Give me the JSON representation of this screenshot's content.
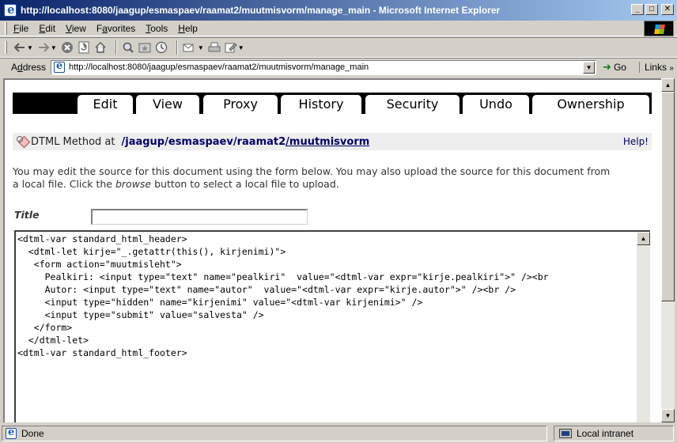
{
  "window": {
    "title": "http://localhost:8080/jaagup/esmaspaev/raamat2/muutmisvorm/manage_main - Microsoft Internet Explorer",
    "min_label": "_",
    "max_label": "□",
    "close_label": "✕"
  },
  "menu": {
    "items": [
      {
        "ul": "F",
        "rest": "ile"
      },
      {
        "ul": "E",
        "rest": "dit"
      },
      {
        "ul": "V",
        "rest": "iew"
      },
      {
        "pre": "F",
        "ul": "a",
        "rest": "vorites"
      },
      {
        "ul": "T",
        "rest": "ools"
      },
      {
        "ul": "H",
        "rest": "elp"
      }
    ]
  },
  "toolbar": {
    "icons": [
      "back-icon",
      "forward-icon",
      "stop-icon",
      "refresh-icon",
      "home-icon",
      "search-icon",
      "favorites-icon",
      "history-icon",
      "mail-icon",
      "print-icon",
      "edit-icon"
    ]
  },
  "address": {
    "label_ul": "d",
    "label_pre": "A",
    "label_rest": "dress",
    "url": "http://localhost:8080/jaagup/esmaspaev/raamat2/muutmisvorm/manage_main",
    "go_label": "Go",
    "links_label": "Links"
  },
  "tabs": [
    {
      "label": "Edit",
      "active": true
    },
    {
      "label": "View"
    },
    {
      "label": "Proxy"
    },
    {
      "label": "History"
    },
    {
      "label": "Security"
    },
    {
      "label": "Undo"
    },
    {
      "label": "Ownership"
    }
  ],
  "path": {
    "type_label": "DTML Method at",
    "segments": [
      "/jaagup",
      "/esmaspaev",
      "/raamat2",
      "/muutmisvorm"
    ],
    "help": "Help!"
  },
  "description": {
    "line1": "You may edit the source for this document using the form below. You may also upload the source for this document from",
    "line2_pre": "a local file. Click the ",
    "line2_em": "browse",
    "line2_post": " button to select a local file to upload."
  },
  "form": {
    "title_label": "Title",
    "title_value": "",
    "source": "<dtml-var standard_html_header>\n  <dtml-let kirje=\"_.getattr(this(), kirjenimi)\">\n   <form action=\"muutmisleht\">\n     Pealkiri: <input type=\"text\" name=\"pealkiri\"  value=\"<dtml-var expr=\"kirje.pealkiri\">\" /><br\n     Autor: <input type=\"text\" name=\"autor\"  value=\"<dtml-var expr=\"kirje.autor\">\" /><br />\n     <input type=\"hidden\" name=\"kirjenimi\" value=\"<dtml-var kirjenimi>\" />\n     <input type=\"submit\" value=\"salvesta\" />\n   </form>\n  </dtml-let>\n<dtml-var standard_html_footer>"
  },
  "status": {
    "text": "Done",
    "zone": "Local intranet"
  }
}
